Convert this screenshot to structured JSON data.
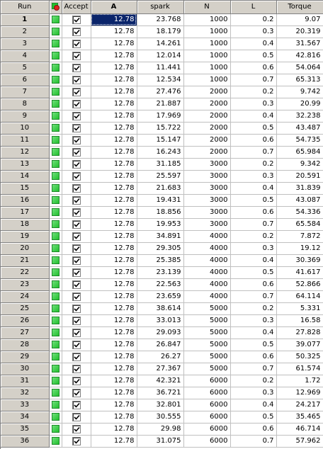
{
  "headers": {
    "run": "Run",
    "status_icon": "status-icon",
    "accept": "Accept",
    "a": "A",
    "spark": "spark",
    "n": "N",
    "l": "L",
    "torque": "Torque"
  },
  "colors": {
    "status_green": "#22c02e",
    "selection": "#0a246a",
    "header_bg": "#d4d0c8"
  },
  "selected_cell": {
    "row": 1,
    "column": "A"
  },
  "rows": [
    {
      "run": "1",
      "a": "12.78",
      "spark": "23.768",
      "n": "1000",
      "l": "0.2",
      "torque": "9.07"
    },
    {
      "run": "2",
      "a": "12.78",
      "spark": "18.179",
      "n": "1000",
      "l": "0.3",
      "torque": "20.319"
    },
    {
      "run": "3",
      "a": "12.78",
      "spark": "14.261",
      "n": "1000",
      "l": "0.4",
      "torque": "31.567"
    },
    {
      "run": "4",
      "a": "12.78",
      "spark": "12.014",
      "n": "1000",
      "l": "0.5",
      "torque": "42.816"
    },
    {
      "run": "5",
      "a": "12.78",
      "spark": "11.441",
      "n": "1000",
      "l": "0.6",
      "torque": "54.064"
    },
    {
      "run": "6",
      "a": "12.78",
      "spark": "12.534",
      "n": "1000",
      "l": "0.7",
      "torque": "65.313"
    },
    {
      "run": "7",
      "a": "12.78",
      "spark": "27.476",
      "n": "2000",
      "l": "0.2",
      "torque": "9.742"
    },
    {
      "run": "8",
      "a": "12.78",
      "spark": "21.887",
      "n": "2000",
      "l": "0.3",
      "torque": "20.99"
    },
    {
      "run": "9",
      "a": "12.78",
      "spark": "17.969",
      "n": "2000",
      "l": "0.4",
      "torque": "32.238"
    },
    {
      "run": "10",
      "a": "12.78",
      "spark": "15.722",
      "n": "2000",
      "l": "0.5",
      "torque": "43.487"
    },
    {
      "run": "11",
      "a": "12.78",
      "spark": "15.147",
      "n": "2000",
      "l": "0.6",
      "torque": "54.735"
    },
    {
      "run": "12",
      "a": "12.78",
      "spark": "16.243",
      "n": "2000",
      "l": "0.7",
      "torque": "65.984"
    },
    {
      "run": "13",
      "a": "12.78",
      "spark": "31.185",
      "n": "3000",
      "l": "0.2",
      "torque": "9.342"
    },
    {
      "run": "14",
      "a": "12.78",
      "spark": "25.597",
      "n": "3000",
      "l": "0.3",
      "torque": "20.591"
    },
    {
      "run": "15",
      "a": "12.78",
      "spark": "21.683",
      "n": "3000",
      "l": "0.4",
      "torque": "31.839"
    },
    {
      "run": "16",
      "a": "12.78",
      "spark": "19.431",
      "n": "3000",
      "l": "0.5",
      "torque": "43.087"
    },
    {
      "run": "17",
      "a": "12.78",
      "spark": "18.856",
      "n": "3000",
      "l": "0.6",
      "torque": "54.336"
    },
    {
      "run": "18",
      "a": "12.78",
      "spark": "19.953",
      "n": "3000",
      "l": "0.7",
      "torque": "65.584"
    },
    {
      "run": "19",
      "a": "12.78",
      "spark": "34.891",
      "n": "4000",
      "l": "0.2",
      "torque": "7.872"
    },
    {
      "run": "20",
      "a": "12.78",
      "spark": "29.305",
      "n": "4000",
      "l": "0.3",
      "torque": "19.12"
    },
    {
      "run": "21",
      "a": "12.78",
      "spark": "25.385",
      "n": "4000",
      "l": "0.4",
      "torque": "30.369"
    },
    {
      "run": "22",
      "a": "12.78",
      "spark": "23.139",
      "n": "4000",
      "l": "0.5",
      "torque": "41.617"
    },
    {
      "run": "23",
      "a": "12.78",
      "spark": "22.563",
      "n": "4000",
      "l": "0.6",
      "torque": "52.866"
    },
    {
      "run": "24",
      "a": "12.78",
      "spark": "23.659",
      "n": "4000",
      "l": "0.7",
      "torque": "64.114"
    },
    {
      "run": "25",
      "a": "12.78",
      "spark": "38.614",
      "n": "5000",
      "l": "0.2",
      "torque": "5.331"
    },
    {
      "run": "26",
      "a": "12.78",
      "spark": "33.013",
      "n": "5000",
      "l": "0.3",
      "torque": "16.58"
    },
    {
      "run": "27",
      "a": "12.78",
      "spark": "29.093",
      "n": "5000",
      "l": "0.4",
      "torque": "27.828"
    },
    {
      "run": "28",
      "a": "12.78",
      "spark": "26.847",
      "n": "5000",
      "l": "0.5",
      "torque": "39.077"
    },
    {
      "run": "29",
      "a": "12.78",
      "spark": "26.27",
      "n": "5000",
      "l": "0.6",
      "torque": "50.325"
    },
    {
      "run": "30",
      "a": "12.78",
      "spark": "27.367",
      "n": "5000",
      "l": "0.7",
      "torque": "61.574"
    },
    {
      "run": "31",
      "a": "12.78",
      "spark": "42.321",
      "n": "6000",
      "l": "0.2",
      "torque": "1.72"
    },
    {
      "run": "32",
      "a": "12.78",
      "spark": "36.721",
      "n": "6000",
      "l": "0.3",
      "torque": "12.969"
    },
    {
      "run": "33",
      "a": "12.78",
      "spark": "32.801",
      "n": "6000",
      "l": "0.4",
      "torque": "24.217"
    },
    {
      "run": "34",
      "a": "12.78",
      "spark": "30.555",
      "n": "6000",
      "l": "0.5",
      "torque": "35.465"
    },
    {
      "run": "35",
      "a": "12.78",
      "spark": "29.98",
      "n": "6000",
      "l": "0.6",
      "torque": "46.714"
    },
    {
      "run": "36",
      "a": "12.78",
      "spark": "31.075",
      "n": "6000",
      "l": "0.7",
      "torque": "57.962"
    }
  ]
}
